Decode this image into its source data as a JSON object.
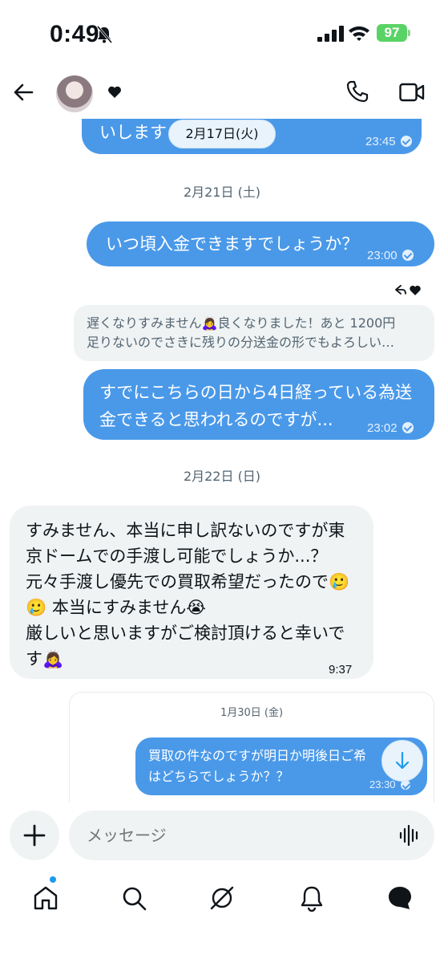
{
  "status_bar": {
    "time": "0:49",
    "battery": "97"
  },
  "header": {
    "contact_avatar": "avatar",
    "contact_badge_icon": "heart-icon"
  },
  "chat": {
    "messages": [
      {
        "text": "いします",
        "time": "23:45",
        "status_icon": "sent-check-icon"
      },
      {
        "text": "いつ頃入金できますでしょうか？",
        "time": "23:00",
        "status_icon": "sent-check-icon"
      },
      {
        "text_line1": "すでにこちらの日から4日経っている為送",
        "text_line2": "金できると思われるのですが...",
        "time": "23:02",
        "status_icon": "sent-check-icon"
      },
      {
        "lines": [
          "すみません、本当に申し訳ないのですが東",
          "京ドームでの手渡し可能でしょうか...？",
          "元々手渡し優先での買取希望だったので🥲",
          "🥲 本当にすみません😭",
          "厳しいと思いますがご検討頂けると幸いで",
          "す🙇‍♀️"
        ],
        "time": "9:37"
      }
    ],
    "date_pill": "2月17日(火)",
    "date_separators": [
      "2月21日 (土)",
      "2月22日 (日)"
    ],
    "reply_quote": {
      "line1": "遅くなりすみません🙇‍♀️良くなりました！あと 1200円",
      "line2": "足りないのでさきに残りの分送金の形でもよろしい…"
    },
    "quoted_card": {
      "date": "1月30日 (金)",
      "line1": "買取の件なのですが明日か明後日ご希",
      "line2": "はどちらでしょうか？？",
      "time": "23:30"
    }
  },
  "composer": {
    "placeholder": "メッセージ"
  },
  "tab_bar": {
    "items": [
      "home-icon",
      "search-icon",
      "grok-icon",
      "notifications-icon",
      "messages-icon"
    ]
  },
  "colors": {
    "outgoing_bubble": "#4a99e9",
    "incoming_bubble": "#eff3f4",
    "accent": "#1d9bf0"
  }
}
